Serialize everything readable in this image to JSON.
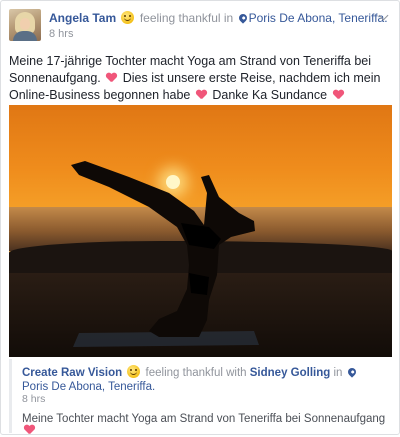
{
  "post": {
    "author": "Angela Tam",
    "feeling": "feeling thankful in",
    "place": "Poris De Abona, Teneriffa.",
    "time": "8 hrs",
    "text_part1": "Meine 17-jährige Tochter macht Yoga am Strand von Teneriffa bei Sonnenaufgang.",
    "text_part2": "Dies ist unsere erste Reise, nachdem ich mein Online-Business begonnen habe",
    "text_part3": "Danke Ka Sundance"
  },
  "shared": {
    "author": "Create Raw Vision",
    "feeling": "feeling thankful with",
    "with": "Sidney Golling",
    "in": "in",
    "place": "Poris De Abona, Teneriffa.",
    "time": "8 hrs",
    "text": "Meine Tochter macht Yoga am Strand von Teneriffa bei Sonnenaufgang"
  },
  "colors": {
    "link": "#365899",
    "meta": "#90949c",
    "heart": "#f0567a"
  },
  "icons": [
    "smiley-emoji-icon",
    "location-pin-icon",
    "chevron-down-icon",
    "heart-icon"
  ]
}
